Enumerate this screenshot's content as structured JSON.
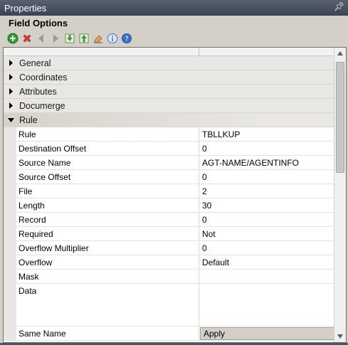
{
  "window": {
    "title": "Properties"
  },
  "panel": {
    "title": "Field Options"
  },
  "toolbar": {
    "buttons": [
      {
        "icon": "add-icon",
        "color": "#2f9e2f"
      },
      {
        "icon": "delete-icon",
        "color": "#d83b2b"
      },
      {
        "icon": "back-icon",
        "color": "#9a9a9a"
      },
      {
        "icon": "forward-icon",
        "color": "#9a9a9a"
      },
      {
        "icon": "move-down-icon",
        "color": "#3c9a3c"
      },
      {
        "icon": "move-up-icon",
        "color": "#3c9a3c"
      },
      {
        "icon": "clear-icon",
        "color": "#c86a2a"
      },
      {
        "icon": "info-icon",
        "color": "#3a73c9"
      },
      {
        "icon": "help-icon",
        "color": "#3a6fd0"
      }
    ]
  },
  "categories": [
    {
      "label": "General",
      "expanded": false
    },
    {
      "label": "Coordinates",
      "expanded": false
    },
    {
      "label": "Attributes",
      "expanded": false
    },
    {
      "label": "Documerge",
      "expanded": false
    },
    {
      "label": "Rule",
      "expanded": true
    }
  ],
  "properties": [
    {
      "name": "Rule",
      "value": "TBLLKUP"
    },
    {
      "name": "Destination Offset",
      "value": "0"
    },
    {
      "name": "Source Name",
      "value": "AGT-NAME/AGENTINFO"
    },
    {
      "name": "Source Offset",
      "value": "0"
    },
    {
      "name": "File",
      "value": "2"
    },
    {
      "name": "Length",
      "value": "30"
    },
    {
      "name": "Record",
      "value": "0"
    },
    {
      "name": "Required",
      "value": "Not"
    },
    {
      "name": "Overflow Multiplier",
      "value": "0"
    },
    {
      "name": "Overflow",
      "value": "Default"
    },
    {
      "name": "Mask",
      "value": ""
    },
    {
      "name": "Data",
      "value": ""
    },
    {
      "name": "Same Name",
      "value": "Apply"
    }
  ]
}
